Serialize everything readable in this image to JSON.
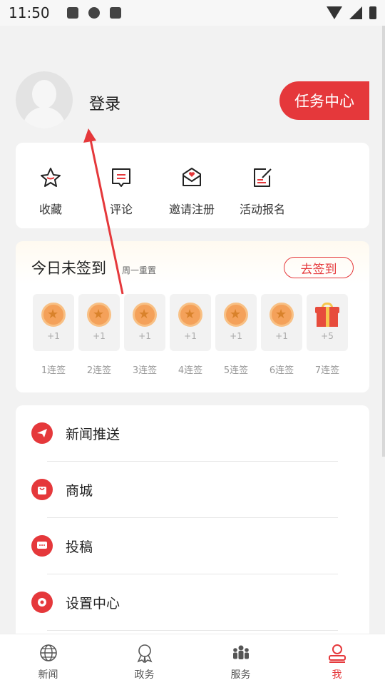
{
  "status_bar": {
    "time": "11:50"
  },
  "profile": {
    "login_label": "登录",
    "task_center_label": "任务中心"
  },
  "quick_actions": [
    {
      "label": "收藏",
      "icon": "star-icon"
    },
    {
      "label": "评论",
      "icon": "comment-icon"
    },
    {
      "label": "邀请注册",
      "icon": "invite-mail-icon"
    },
    {
      "label": "活动报名",
      "icon": "edit-form-icon"
    }
  ],
  "signin": {
    "title": "今日未签到",
    "subtitle": "周一重置",
    "button_label": "去签到",
    "days": [
      {
        "reward": "+1",
        "label": "1连签",
        "icon": "coin-icon"
      },
      {
        "reward": "+1",
        "label": "2连签",
        "icon": "coin-icon"
      },
      {
        "reward": "+1",
        "label": "3连签",
        "icon": "coin-icon"
      },
      {
        "reward": "+1",
        "label": "4连签",
        "icon": "coin-icon"
      },
      {
        "reward": "+1",
        "label": "5连签",
        "icon": "coin-icon"
      },
      {
        "reward": "+1",
        "label": "6连签",
        "icon": "coin-icon"
      },
      {
        "reward": "+5",
        "label": "7连签",
        "icon": "gift-icon"
      }
    ]
  },
  "menu": [
    {
      "label": "新闻推送",
      "icon": "paper-plane-icon"
    },
    {
      "label": "商城",
      "icon": "shopping-bag-icon"
    },
    {
      "label": "投稿",
      "icon": "chat-bubble-icon"
    },
    {
      "label": "设置中心",
      "icon": "gear-icon"
    }
  ],
  "tabs": [
    {
      "label": "新闻",
      "icon": "globe-icon",
      "active": false
    },
    {
      "label": "政务",
      "icon": "award-icon",
      "active": false
    },
    {
      "label": "服务",
      "icon": "people-icon",
      "active": false
    },
    {
      "label": "我",
      "icon": "user-icon",
      "active": true
    }
  ],
  "colors": {
    "accent": "#e5383b",
    "background": "#f2f2f2",
    "card": "#ffffff"
  }
}
